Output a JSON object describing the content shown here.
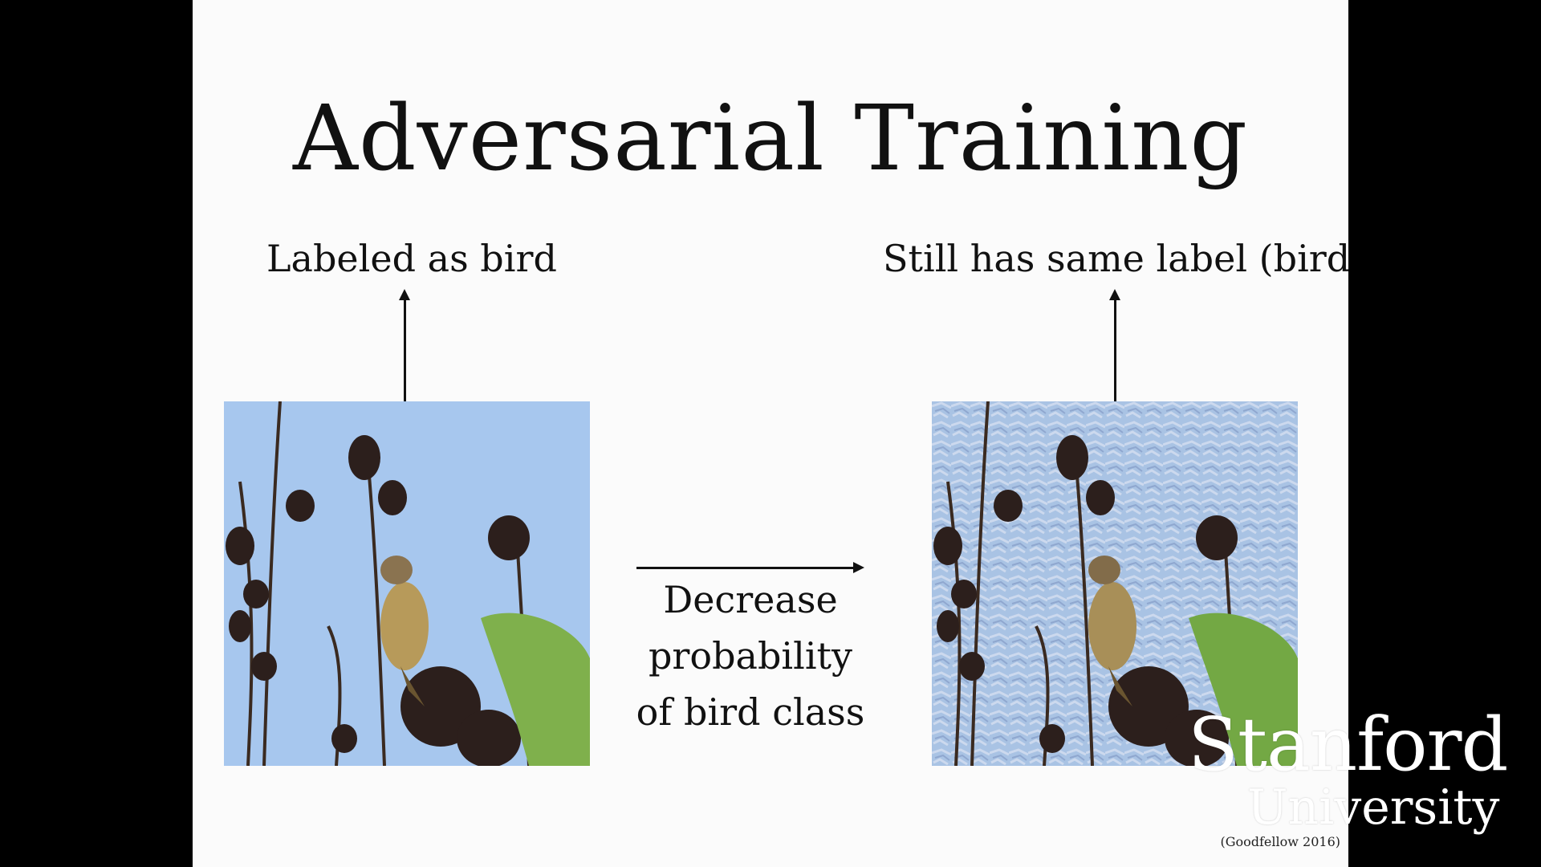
{
  "slide": {
    "title": "Adversarial Training",
    "left_label": "Labeled as bird",
    "right_label": "Still has same label (bird)",
    "caption_lines": [
      "Decrease",
      "probability",
      "of bird class"
    ],
    "citation": "(Goodfellow 2016)"
  },
  "watermark": {
    "line1": "Stanford",
    "line2": "University"
  },
  "colors": {
    "sky": "#a7c7ee",
    "slide_background": "#fbfbfb",
    "letterbox": "#000000"
  }
}
